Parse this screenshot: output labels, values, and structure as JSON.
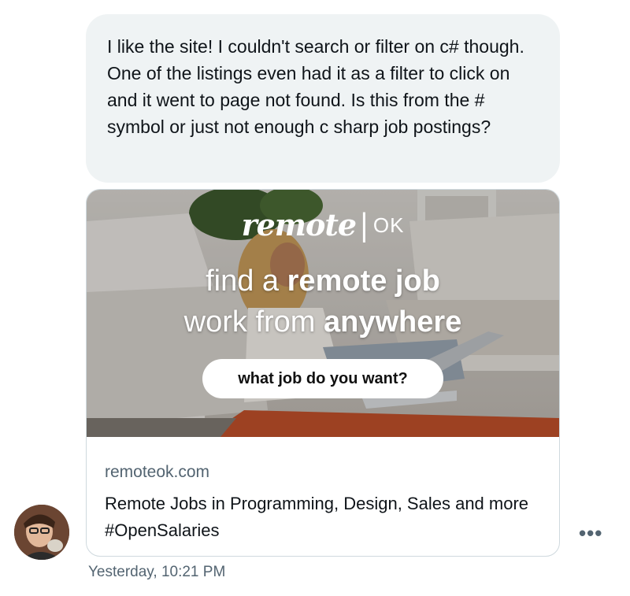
{
  "message": {
    "text": "I like the site! I couldn't search or filter on c# though. One of the listings even had it as a filter to click on and it went to page not found. Is this from the # symbol or just not enough c sharp job postings?"
  },
  "link_card": {
    "image": {
      "brand_name": "remote",
      "brand_suffix": "OK",
      "headline_line1_light": "find a ",
      "headline_line1_bold": "remote job",
      "headline_line2_light": "work from ",
      "headline_line2_bold": "anywhere",
      "search_text": "what job do you want?"
    },
    "domain": "remoteok.com",
    "title": "Remote Jobs in Programming, Design, Sales and more #OpenSalaries"
  },
  "meta": {
    "timestamp": "Yesterday, 10:21 PM",
    "more_label": "•••"
  },
  "colors": {
    "bubble_bg": "#eff3f4",
    "secondary_text": "#536471",
    "card_border": "#cfd9de"
  }
}
